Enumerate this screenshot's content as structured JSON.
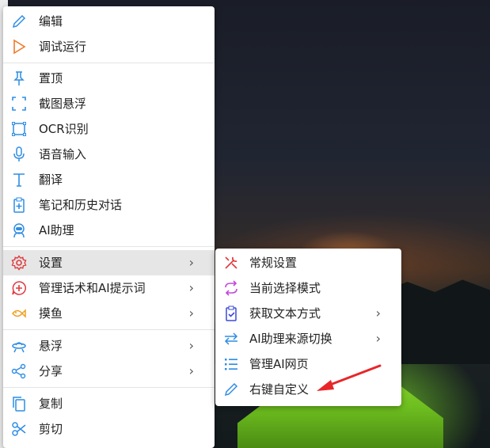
{
  "main_menu": {
    "items": [
      {
        "label": "编辑",
        "icon": "pencil-icon"
      },
      {
        "label": "调试运行",
        "icon": "play-icon"
      },
      {
        "label": "置顶",
        "icon": "pin-icon"
      },
      {
        "label": "截图悬浮",
        "icon": "screenshot-frame-icon"
      },
      {
        "label": "OCR识别",
        "icon": "ocr-scan-icon"
      },
      {
        "label": "语音输入",
        "icon": "microphone-icon"
      },
      {
        "label": "翻译",
        "icon": "translate-t-icon"
      },
      {
        "label": "笔记和历史对话",
        "icon": "clipboard-plus-icon"
      },
      {
        "label": "AI助理",
        "icon": "robot-icon"
      },
      {
        "label": "设置",
        "icon": "gear-icon",
        "submenu": true,
        "active": true
      },
      {
        "label": "管理话术和AI提示词",
        "icon": "add-speech-icon",
        "submenu": true
      },
      {
        "label": "摸鱼",
        "icon": "fish-icon",
        "submenu": true
      },
      {
        "label": "悬浮",
        "icon": "ufo-icon",
        "submenu": true
      },
      {
        "label": "分享",
        "icon": "share-icon",
        "submenu": true
      },
      {
        "label": "复制",
        "icon": "copy-icon"
      },
      {
        "label": "剪切",
        "icon": "scissors-icon"
      }
    ]
  },
  "sub_menu": {
    "items": [
      {
        "label": "常规设置",
        "icon": "tools-icon"
      },
      {
        "label": "当前选择模式",
        "icon": "cycle-arrows-icon"
      },
      {
        "label": "获取文本方式",
        "icon": "clipboard-check-icon",
        "submenu": true
      },
      {
        "label": "AI助理来源切换",
        "icon": "swap-arrows-icon",
        "submenu": true
      },
      {
        "label": "管理AI网页",
        "icon": "list-icon"
      },
      {
        "label": "右键自定义",
        "icon": "pencil-icon"
      }
    ]
  },
  "submenu_arrow": "›",
  "colors": {
    "accent_blue": "#2f8de4",
    "red": "#e0393e",
    "orange": "#f0a020",
    "purple": "#c24ad8",
    "green": "#3aa060"
  }
}
